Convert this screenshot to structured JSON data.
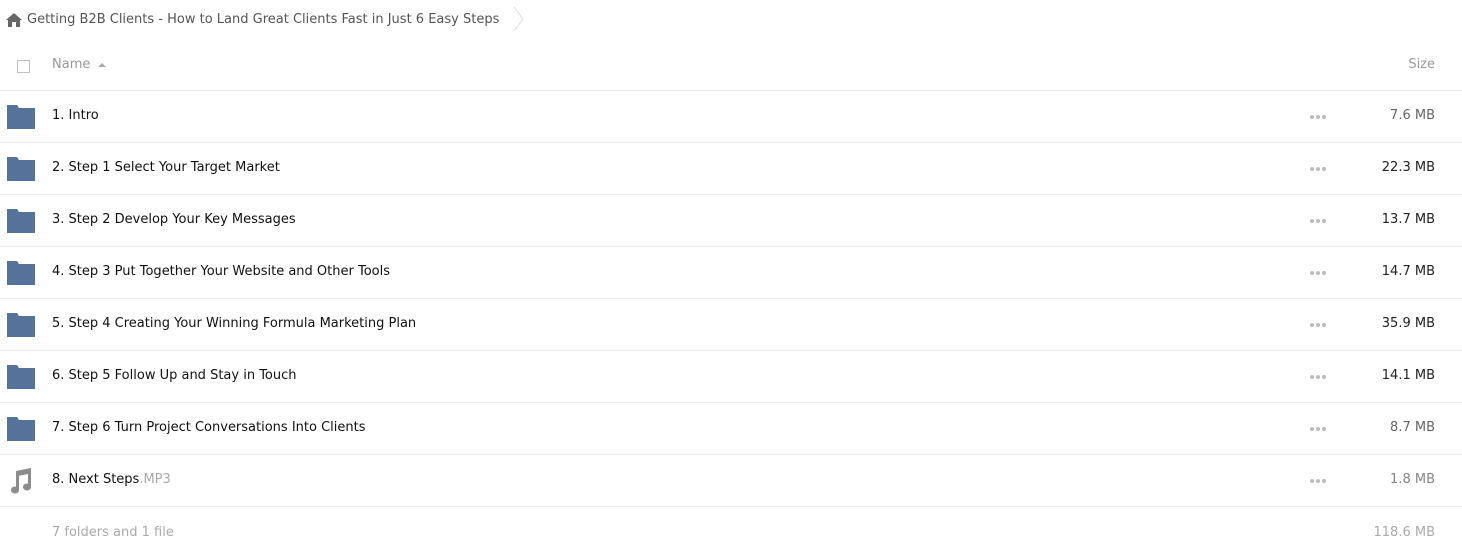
{
  "breadcrumb": {
    "home_icon": "home-icon",
    "title": "Getting B2B Clients - How to Land Great Clients Fast in Just 6 Easy Steps",
    "separator_icon": "chevron-right-icon"
  },
  "table": {
    "columns": {
      "name": "Name",
      "size": "Size",
      "sort": "ascending"
    },
    "rows": [
      {
        "type": "folder",
        "icon": "folder-icon",
        "name": "1. Intro",
        "ext": "",
        "size": "7.6 MB",
        "size_color": "#666666"
      },
      {
        "type": "folder",
        "icon": "folder-icon",
        "name": "2. Step 1 Select Your Target Market",
        "ext": "",
        "size": "22.3 MB",
        "size_color": "#222222"
      },
      {
        "type": "folder",
        "icon": "folder-icon",
        "name": "3. Step 2 Develop Your Key Messages",
        "ext": "",
        "size": "13.7 MB",
        "size_color": "#222222"
      },
      {
        "type": "folder",
        "icon": "folder-icon",
        "name": "4. Step 3 Put Together Your Website and Other Tools",
        "ext": "",
        "size": "14.7 MB",
        "size_color": "#222222"
      },
      {
        "type": "folder",
        "icon": "folder-icon",
        "name": "5. Step 4 Creating Your Winning Formula Marketing Plan",
        "ext": "",
        "size": "35.9 MB",
        "size_color": "#222222"
      },
      {
        "type": "folder",
        "icon": "folder-icon",
        "name": "6. Step 5 Follow Up and Stay in Touch",
        "ext": "",
        "size": "14.1 MB",
        "size_color": "#222222"
      },
      {
        "type": "folder",
        "icon": "folder-icon",
        "name": "7. Step 6 Turn Project Conversations Into Clients",
        "ext": "",
        "size": "8.7 MB",
        "size_color": "#666666"
      },
      {
        "type": "file",
        "icon": "music-note-icon",
        "name": "8. Next Steps",
        "ext": ".MP3",
        "size": "1.8 MB",
        "size_color": "#888888"
      }
    ]
  },
  "footer": {
    "summary": "7 folders and 1 file",
    "total_size": "118.6 MB"
  },
  "colors": {
    "folder": "#54729a",
    "music_icon": "#8c8c8c"
  }
}
